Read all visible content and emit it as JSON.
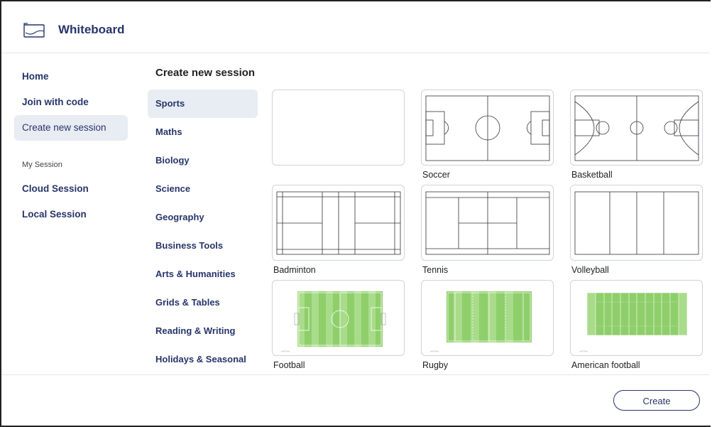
{
  "app": {
    "title": "Whiteboard",
    "icon": "whiteboard-icon"
  },
  "nav": {
    "home": "Home",
    "join": "Join with code",
    "create": "Create new session",
    "section_label": "My Session",
    "cloud": "Cloud Session",
    "local": "Local Session"
  },
  "main": {
    "title": "Create new session",
    "categories": [
      "Sports",
      "Maths",
      "Biology",
      "Science",
      "Geography",
      "Business Tools",
      "Arts & Humanities",
      "Grids & Tables",
      "Reading & Writing",
      "Holidays & Seasonal"
    ],
    "selected_category": "Sports",
    "templates": [
      {
        "label": ""
      },
      {
        "label": "Soccer"
      },
      {
        "label": "Basketball"
      },
      {
        "label": "Badminton"
      },
      {
        "label": "Tennis"
      },
      {
        "label": "Volleyball"
      },
      {
        "label": "Football"
      },
      {
        "label": "Rugby"
      },
      {
        "label": "American football"
      }
    ]
  },
  "footer": {
    "create_label": "Create"
  },
  "colors": {
    "accent": "#27356a",
    "selected_bg": "#e8ecf3",
    "field_green": "#8fcf6b",
    "field_green_light": "#a9dc8a"
  }
}
